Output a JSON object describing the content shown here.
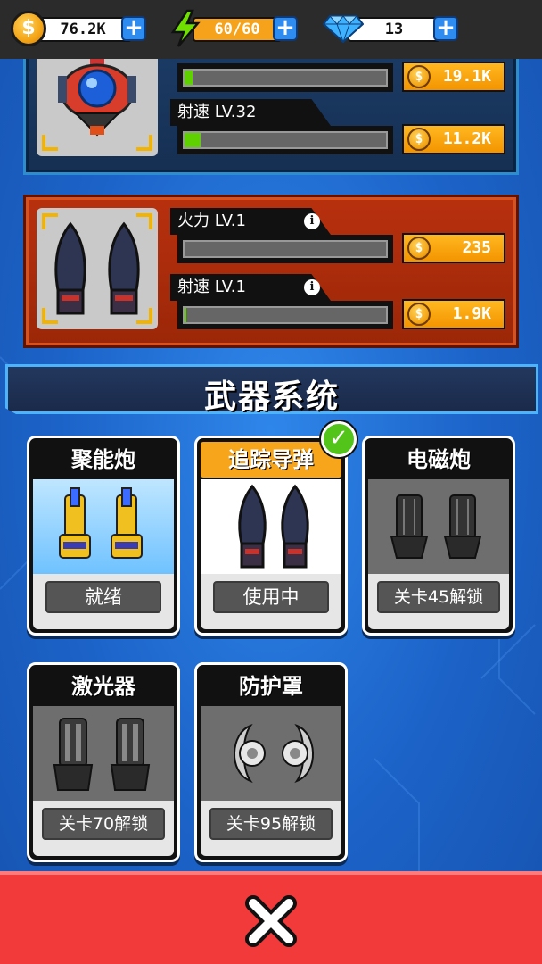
{
  "resources": {
    "coins": "76.2K",
    "energy": "60/60",
    "gems": "13"
  },
  "upgrade_panels": [
    {
      "rows": [
        {
          "label": "",
          "fill": 0.04,
          "cost": "19.1K"
        },
        {
          "label": "射速 LV.32",
          "fill": 0.08,
          "cost": "11.2K"
        }
      ]
    },
    {
      "rows": [
        {
          "label": "火力 LV.1",
          "fill": 0.0,
          "cost": "235"
        },
        {
          "label": "射速 LV.1",
          "fill": 0.01,
          "cost": "1.9K"
        }
      ]
    }
  ],
  "section_title": "武器系统",
  "weapons": [
    {
      "name": "聚能炮",
      "status": "就绪"
    },
    {
      "name": "追踪导弹",
      "status": "使用中"
    },
    {
      "name": "电磁炮",
      "status": "关卡45解锁"
    },
    {
      "name": "激光器",
      "status": "关卡70解锁"
    },
    {
      "name": "防护罩",
      "status": "关卡95解锁"
    }
  ],
  "colors": {
    "accent_orange": "#f7a51a",
    "progress_green": "#5fd000",
    "close_red": "#f23a3a",
    "equipped_check": "#52c41a"
  }
}
